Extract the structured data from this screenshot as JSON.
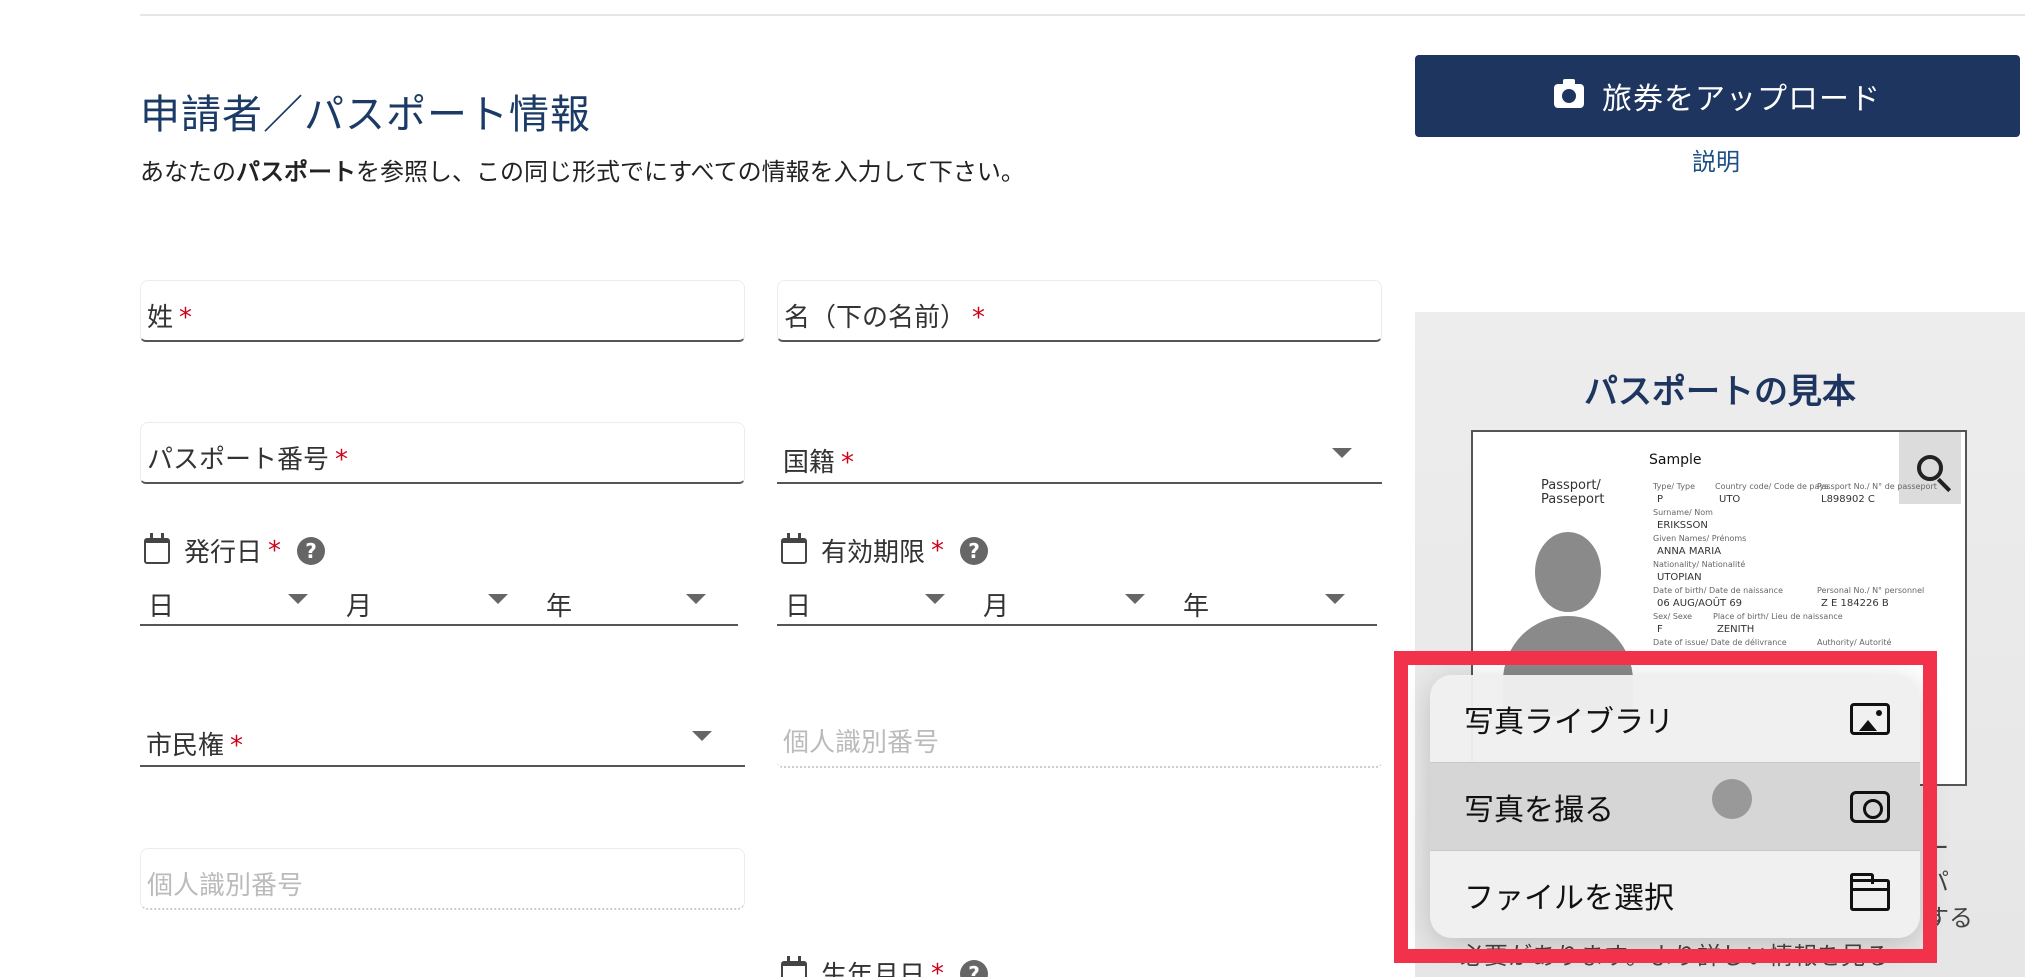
{
  "section": {
    "title": "申請者／パスポート情報",
    "desc_pre": "あなたの",
    "desc_bold": "パスポート",
    "desc_post": "を参照し、この同じ形式でにすべての情報を入力して下さい。"
  },
  "required_mark": "*",
  "fields": {
    "surname": "姓",
    "given_name": "名（下の名前）",
    "passport_number": "パスポート番号",
    "nationality": "国籍",
    "citizenship": "市民権",
    "personal_id_1": "個人識別番号",
    "personal_id_2": "個人識別番号"
  },
  "dates": {
    "issue_label": "発行日",
    "expiry_label": "有効期限",
    "birth_label": "生年月日",
    "help": "?",
    "day": "日",
    "month": "月",
    "year": "年"
  },
  "upload": {
    "button_label": "旅券をアップロード",
    "explain_link": "説明"
  },
  "sample": {
    "title": "パスポートの見本",
    "passport_title": "Passport/",
    "passport_title2": "Passeport",
    "sample_word": "Sample",
    "type_lbl": "Type/ Type",
    "type_val": "P",
    "country_lbl": "Country code/ Code de pays",
    "country_val": "UTO",
    "number_lbl": "Passport No./ N° de passeport",
    "number_val": "L898902 C",
    "surname_lbl": "Surname/ Nom",
    "surname_val": "ERIKSSON",
    "given_lbl": "Given Names/ Prénoms",
    "given_val": "ANNA MARIA",
    "nat_lbl": "Nationality/ Nationalité",
    "nat_val": "UTOPIAN",
    "dob_lbl": "Date of birth/ Date de naissance",
    "dob_val": "06 AUG/AOÛT 69",
    "pn_lbl": "Personal No./ N° personnel",
    "pn_val": "Z E 184226 B",
    "sex_lbl": "Sex/ Sexe",
    "sex_val": "F",
    "pob_lbl": "Place of birth/ Lieu de naissance",
    "pob_val": "ZENITH",
    "doi_lbl": "Date of issue/ Date de délivrance",
    "auth_lbl": "Authority/ Autorité"
  },
  "side_fragments": [
    "ー",
    "パ",
    "する"
  ],
  "bottom_fragment": "必要があります。より詳しい情報を見る",
  "menu": {
    "items": [
      {
        "label": "写真ライブラリ",
        "icon": "photo-library-icon"
      },
      {
        "label": "写真を撮る",
        "icon": "camera-icon"
      },
      {
        "label": "ファイルを選択",
        "icon": "folder-icon"
      }
    ]
  },
  "colors": {
    "navy": "#1e3560",
    "required": "#d0021b",
    "highlight_frame": "#f2324b"
  }
}
